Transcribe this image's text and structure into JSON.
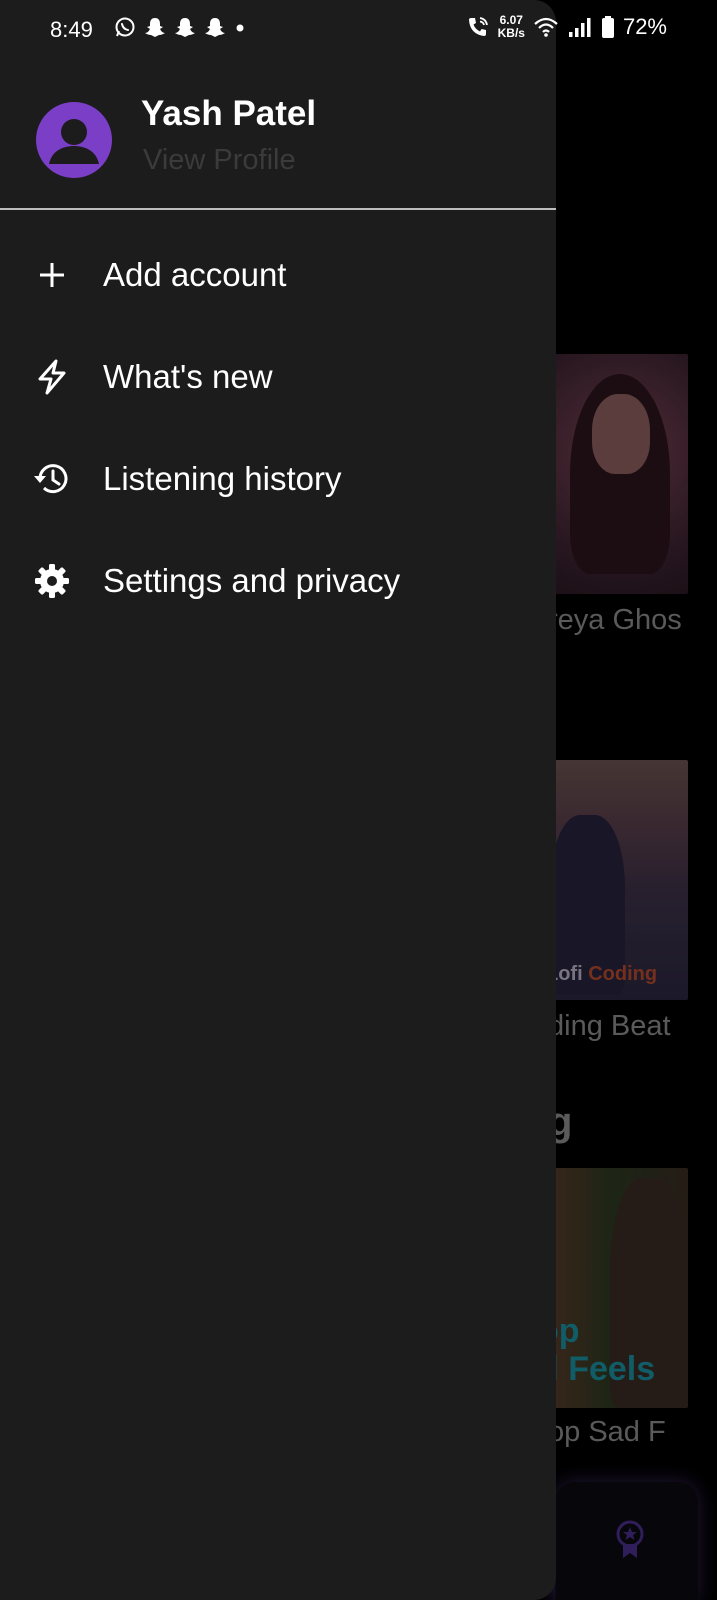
{
  "status_bar": {
    "time": "8:49",
    "notification_icons": [
      "whatsapp-icon",
      "snapchat-icon",
      "snapchat-icon",
      "snapchat-icon",
      "dot-icon"
    ],
    "net_speed_value": "6.07",
    "net_speed_unit": "KB/s",
    "battery_percent": "72%"
  },
  "drawer": {
    "profile": {
      "name": "Yash Patel",
      "link_label": "View Profile",
      "avatar_color": "#7a3fc6"
    },
    "menu": [
      {
        "label": "Add account",
        "icon": "plus-icon"
      },
      {
        "label": "What's new",
        "icon": "lightning-icon"
      },
      {
        "label": "Listening history",
        "icon": "history-icon"
      },
      {
        "label": "Settings and privacy",
        "icon": "gear-icon"
      }
    ]
  },
  "background": {
    "captions": [
      "reya Ghos",
      "ding Beat",
      "op Sad F"
    ],
    "section_heading_fragment": "g",
    "card_2_text": {
      "part1": "Lofi",
      "part2": "Coding"
    },
    "card_3_text": {
      "line1": "op",
      "line2": "d Feels"
    }
  },
  "colors": {
    "drawer_bg": "#1c1c1c",
    "accent_purple": "#7a3fc6",
    "divider": "#bdbdbd"
  }
}
